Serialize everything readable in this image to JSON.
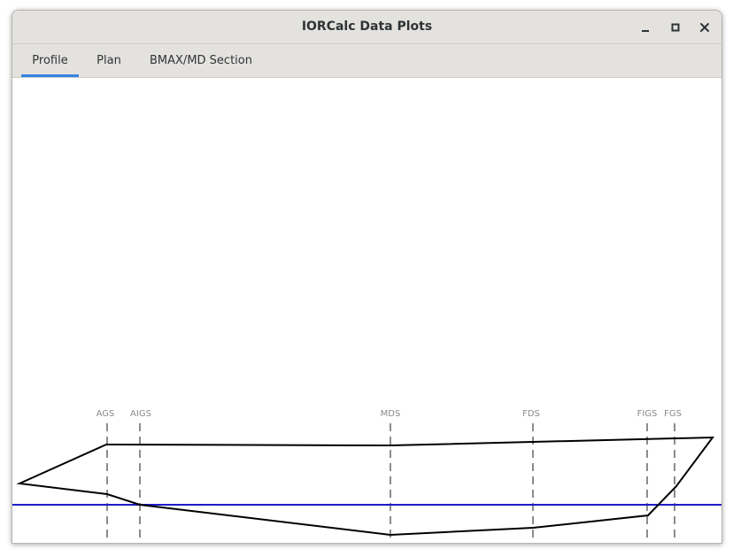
{
  "window": {
    "title": "IORCalc Data Plots",
    "controls": [
      "minimize-icon",
      "maximize-icon",
      "close-icon"
    ]
  },
  "tabs": [
    {
      "label": "Profile",
      "active": true
    },
    {
      "label": "Plan",
      "active": false
    },
    {
      "label": "BMAX/MD Section",
      "active": false
    }
  ],
  "plot": {
    "stations": [
      {
        "label": "AGS"
      },
      {
        "label": "AIGS"
      },
      {
        "label": "MDS"
      },
      {
        "label": "FDS"
      },
      {
        "label": "FIGS"
      },
      {
        "label": "FGS"
      }
    ],
    "colors": {
      "hull_outline": "#000000",
      "waterline": "#1c1cc8",
      "station_line": "#8c8c8c",
      "tab_accent": "#3584e4"
    }
  }
}
